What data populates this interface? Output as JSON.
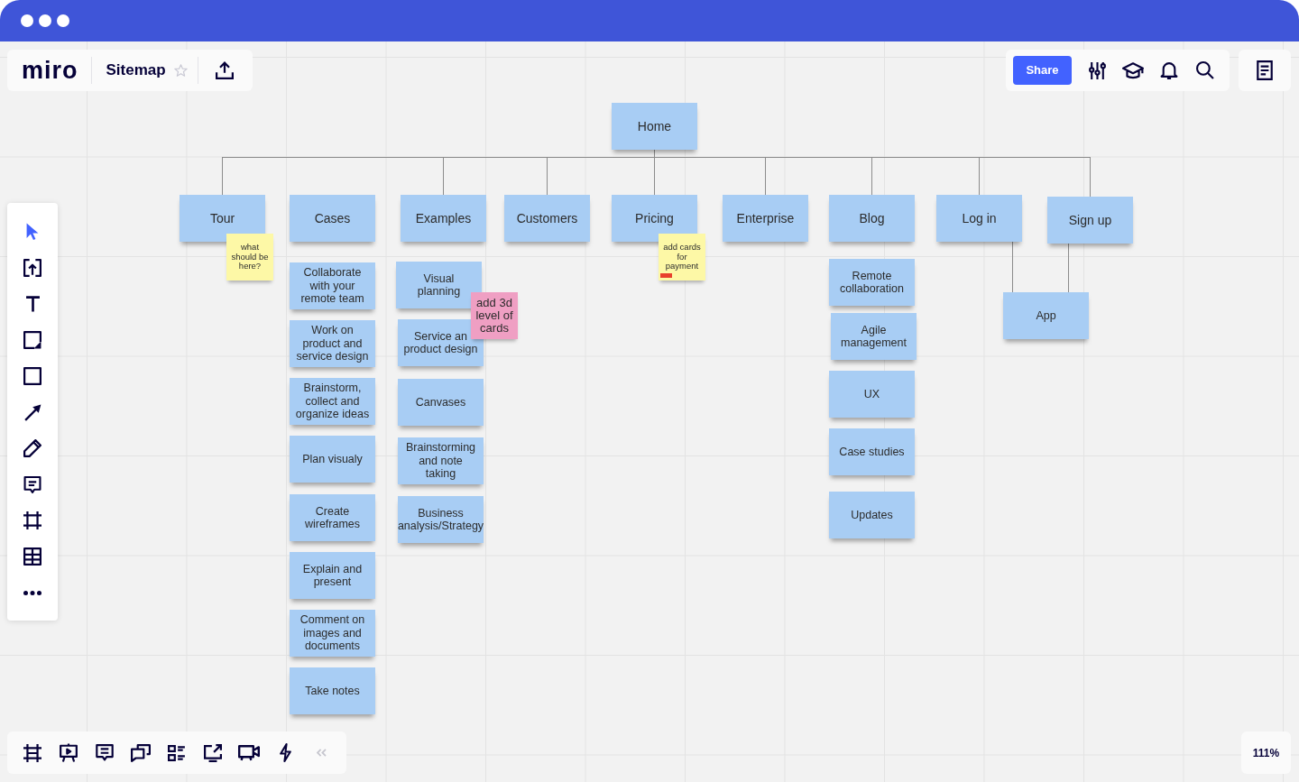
{
  "header": {
    "logo": "miro",
    "board_title": "Sitemap",
    "starred": false
  },
  "top_bar": {
    "share_button": "Share"
  },
  "left_toolbar": [
    {
      "kind": "select",
      "selected": true
    },
    {
      "kind": "upload",
      "selected": false
    },
    {
      "kind": "text",
      "selected": false
    },
    {
      "kind": "sticky_note",
      "selected": false
    },
    {
      "kind": "shape",
      "selected": false
    },
    {
      "kind": "arrow",
      "selected": false
    },
    {
      "kind": "pen",
      "selected": false
    },
    {
      "kind": "comment",
      "selected": false
    },
    {
      "kind": "frame",
      "selected": false
    },
    {
      "kind": "table",
      "selected": false
    },
    {
      "kind": "more",
      "selected": false
    }
  ],
  "sitemap": {
    "root": {
      "label": "Home"
    },
    "sections": [
      {
        "label": "Tour",
        "linked": true,
        "drop_link": false,
        "note": {
          "text": "what should be here?",
          "color": "#fdf8a6",
          "flagged": false
        }
      },
      {
        "label": "Cases",
        "linked": false,
        "drop_link": false,
        "children": [
          {
            "label": "Collaborate with your remote team"
          },
          {
            "label": "Work on product and service design"
          },
          {
            "label": "Brainstorm, collect and organize ideas"
          },
          {
            "label": "Plan visualy"
          },
          {
            "label": "Create wireframes"
          },
          {
            "label": "Explain and present"
          },
          {
            "label": "Comment on images and documents"
          },
          {
            "label": "Take notes"
          }
        ]
      },
      {
        "label": "Examples",
        "linked": true,
        "drop_link": false,
        "children": [
          {
            "label": "Visual planning",
            "note": {
              "text": "add 3d level of cards",
              "color": "#ef9fc3",
              "flagged": false
            }
          },
          {
            "label": "Service an product design"
          },
          {
            "label": "Canvases"
          },
          {
            "label": "Brainstorming and note taking"
          },
          {
            "label": "Business analysis/Strategy"
          }
        ]
      },
      {
        "label": "Customers",
        "linked": true,
        "drop_link": false
      },
      {
        "label": "Pricing",
        "linked": true,
        "drop_link": false,
        "note": {
          "text": "add cards for payment",
          "color": "#fdf8a6",
          "flagged": true
        }
      },
      {
        "label": "Enterprise",
        "linked": true,
        "drop_link": false
      },
      {
        "label": "Blog",
        "linked": true,
        "drop_link": false,
        "children": [
          {
            "label": "Remote collaboration"
          },
          {
            "label": "Agile management"
          },
          {
            "label": "UX"
          },
          {
            "label": "Case studies"
          },
          {
            "label": "Updates"
          }
        ]
      },
      {
        "label": "Log in",
        "linked": true,
        "drop_link": true
      },
      {
        "label": "Sign up",
        "linked": true,
        "drop_link": true,
        "children": [
          {
            "label": "App"
          }
        ]
      }
    ]
  },
  "zoom": "111%"
}
